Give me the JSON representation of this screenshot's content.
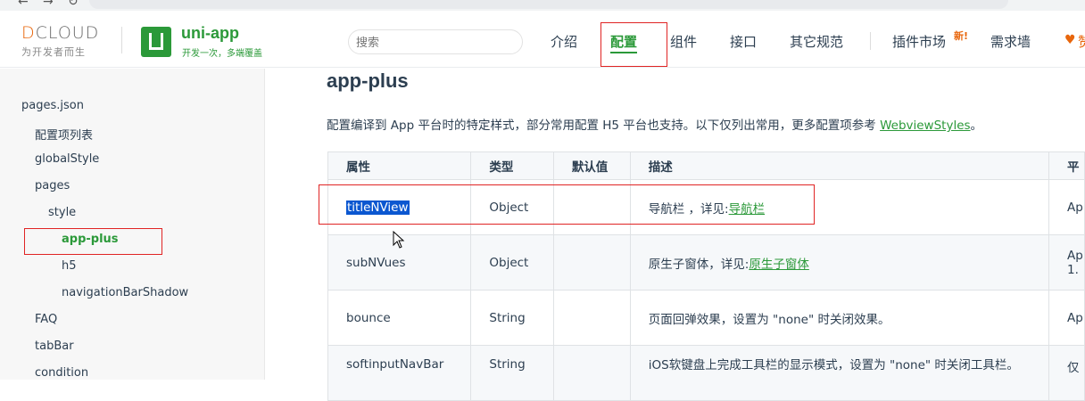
{
  "header": {
    "dcloud_brand_d": "D",
    "dcloud_brand_rest": "CLOUD",
    "dcloud_tagline": "为开发者而生",
    "uni_title": "uni-app",
    "uni_subtitle": "开发一次，多端覆盖",
    "search_placeholder": "搜索",
    "nav": [
      {
        "label": "介绍"
      },
      {
        "label": "配置"
      },
      {
        "label": "组件"
      },
      {
        "label": "接口"
      },
      {
        "label": "其它规范"
      },
      {
        "label": "插件市场"
      },
      {
        "label": "需求墙"
      }
    ],
    "new_badge": "新!",
    "heart_icon": "♥",
    "heart_label": "赞"
  },
  "sidebar": {
    "items": [
      {
        "label": "pages.json"
      },
      {
        "label": "配置项列表"
      },
      {
        "label": "globalStyle"
      },
      {
        "label": "pages"
      },
      {
        "label": "style"
      },
      {
        "label": "app-plus"
      },
      {
        "label": "h5"
      },
      {
        "label": "navigationBarShadow"
      },
      {
        "label": "FAQ"
      },
      {
        "label": "tabBar"
      },
      {
        "label": "condition"
      }
    ]
  },
  "main": {
    "heading": "app-plus",
    "intro_text": "配置编译到 App 平台时的特定样式，部分常用配置 H5 平台也支持。以下仅列出常用，更多配置项参考 ",
    "intro_link": "WebviewStyles",
    "intro_end": "。",
    "table": {
      "headers": [
        "属性",
        "类型",
        "默认值",
        "描述",
        "平"
      ],
      "rows": [
        {
          "prop": "titleNView",
          "type": "Object",
          "default": "",
          "desc": "导航栏 ，详见:",
          "desc_link": "导航栏",
          "platform": "Ap"
        },
        {
          "prop": "subNVues",
          "type": "Object",
          "default": "",
          "desc": "原生子窗体，详见:",
          "desc_link": "原生子窗体",
          "platform": "Ap",
          "platform2": "1."
        },
        {
          "prop": "bounce",
          "type": "String",
          "default": "",
          "desc": "页面回弹效果，设置为 \"none\" 时关闭效果。",
          "desc_link": "",
          "platform": "Ap"
        },
        {
          "prop": "softinputNavBar",
          "type": "String",
          "default": "",
          "desc": "iOS软键盘上完成工具栏的显示模式，设置为 \"none\" 时关闭工具栏。",
          "desc_link": "",
          "platform": "仅"
        }
      ]
    }
  },
  "colors": {
    "accent": "#2b9939",
    "highlight_box": "#e02424",
    "selection": "#0b57d0",
    "brand_orange": "#e8660c"
  }
}
